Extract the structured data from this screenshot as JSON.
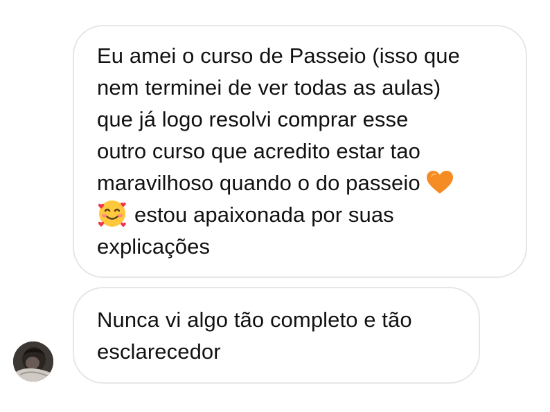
{
  "conversation": {
    "messages": [
      {
        "lines": [
          "Eu amei o curso de Passeio (isso que",
          "nem terminei de ver todas as aulas)",
          "que já logo resolvi comprar esse",
          "outro curso que acredito estar tao",
          "maravilhoso quando o do passeio",
          "estou apaixonada por suas",
          "explicações"
        ],
        "emojis": [
          "orange-heart-icon",
          "smiling-face-with-hearts-icon"
        ]
      },
      {
        "lines": [
          "Nunca vi algo tão completo e tão",
          "esclarecedor"
        ]
      }
    ],
    "colors": {
      "bubble_border": "#e6e6e6",
      "text": "#111111",
      "heart": "#f48c23",
      "smile_face": "#ffc83d"
    }
  }
}
